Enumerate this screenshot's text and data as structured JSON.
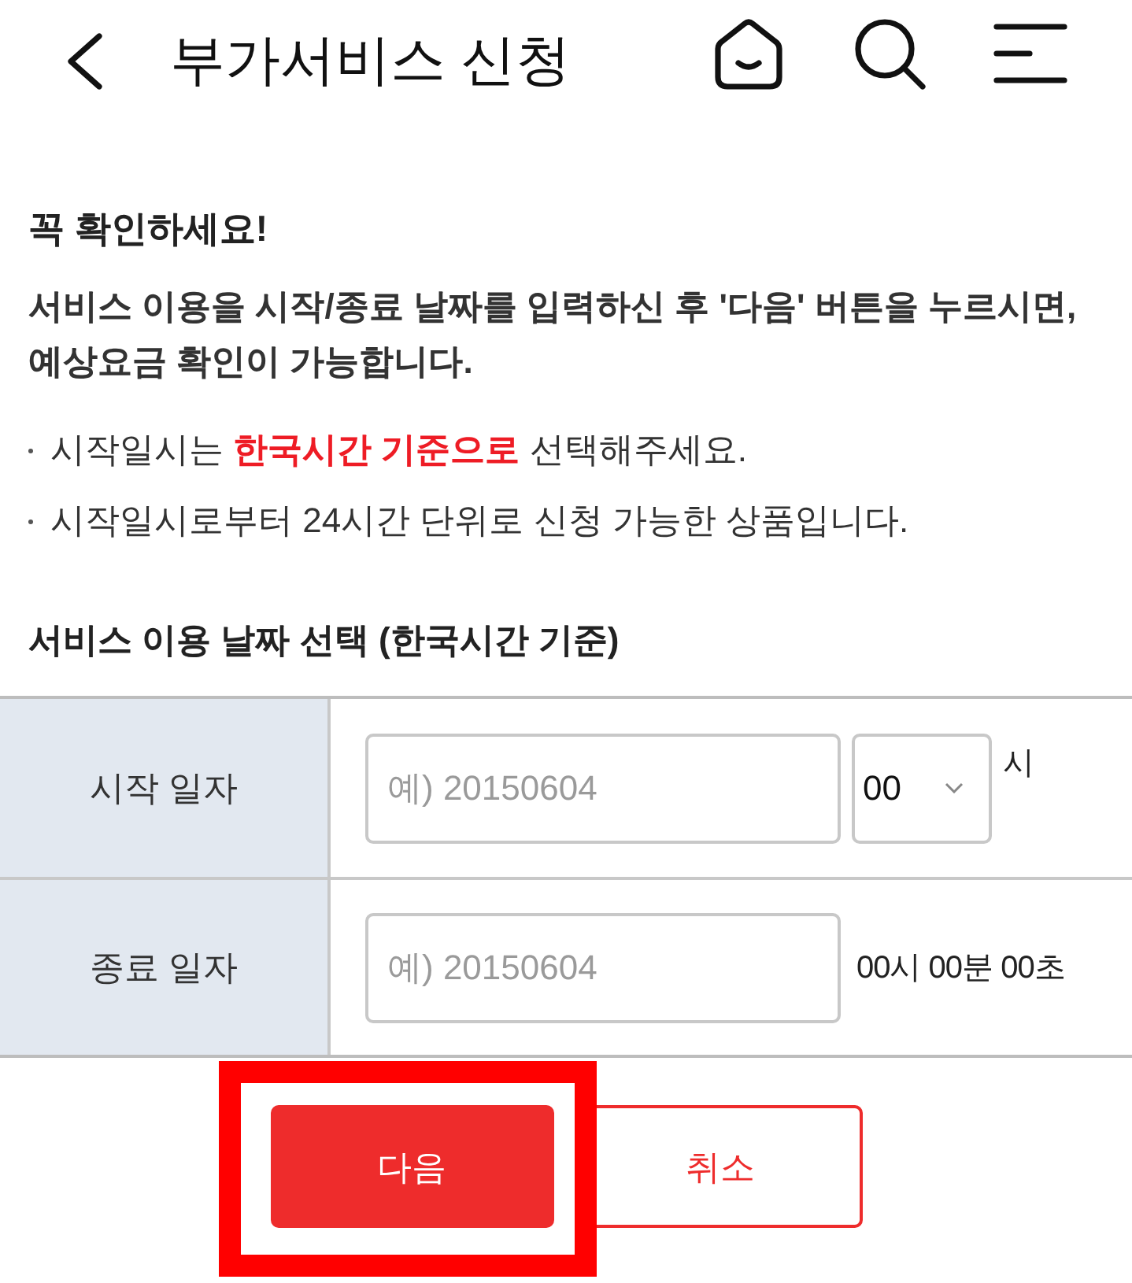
{
  "header": {
    "title": "부가서비스 신청"
  },
  "notice": {
    "heading": "꼭 확인하세요!",
    "lead": "서비스 이용을 시작/종료 날짜를 입력하신 후 '다음' 버튼을 누르시면,\n예상요금 확인이 가능합니다.",
    "bullets": [
      "시작일시는 **한국시간 기준으로** 선택해주세요.",
      "시작일시로부터 24시간 단위로 신청 가능한 상품입니다."
    ]
  },
  "date_section": {
    "title": "서비스 이용 날짜 선택 (한국시간 기준)",
    "rows": [
      {
        "kind": "date_hour",
        "label": "시작 일자",
        "date_field": {
          "placeholder": "예) 20150604"
        },
        "hour_select": {
          "value": "00"
        },
        "suffix": "시"
      },
      {
        "kind": "date_fixed",
        "label": "종료 일자",
        "date_field": {
          "placeholder": "예) 20150604"
        },
        "suffix": "00시 00분 00초"
      }
    ]
  },
  "buttons": [
    {
      "kind": "primary",
      "label": "다음",
      "highlighted": true
    },
    {
      "kind": "secondary",
      "label": "취소",
      "highlighted": false
    }
  ]
}
